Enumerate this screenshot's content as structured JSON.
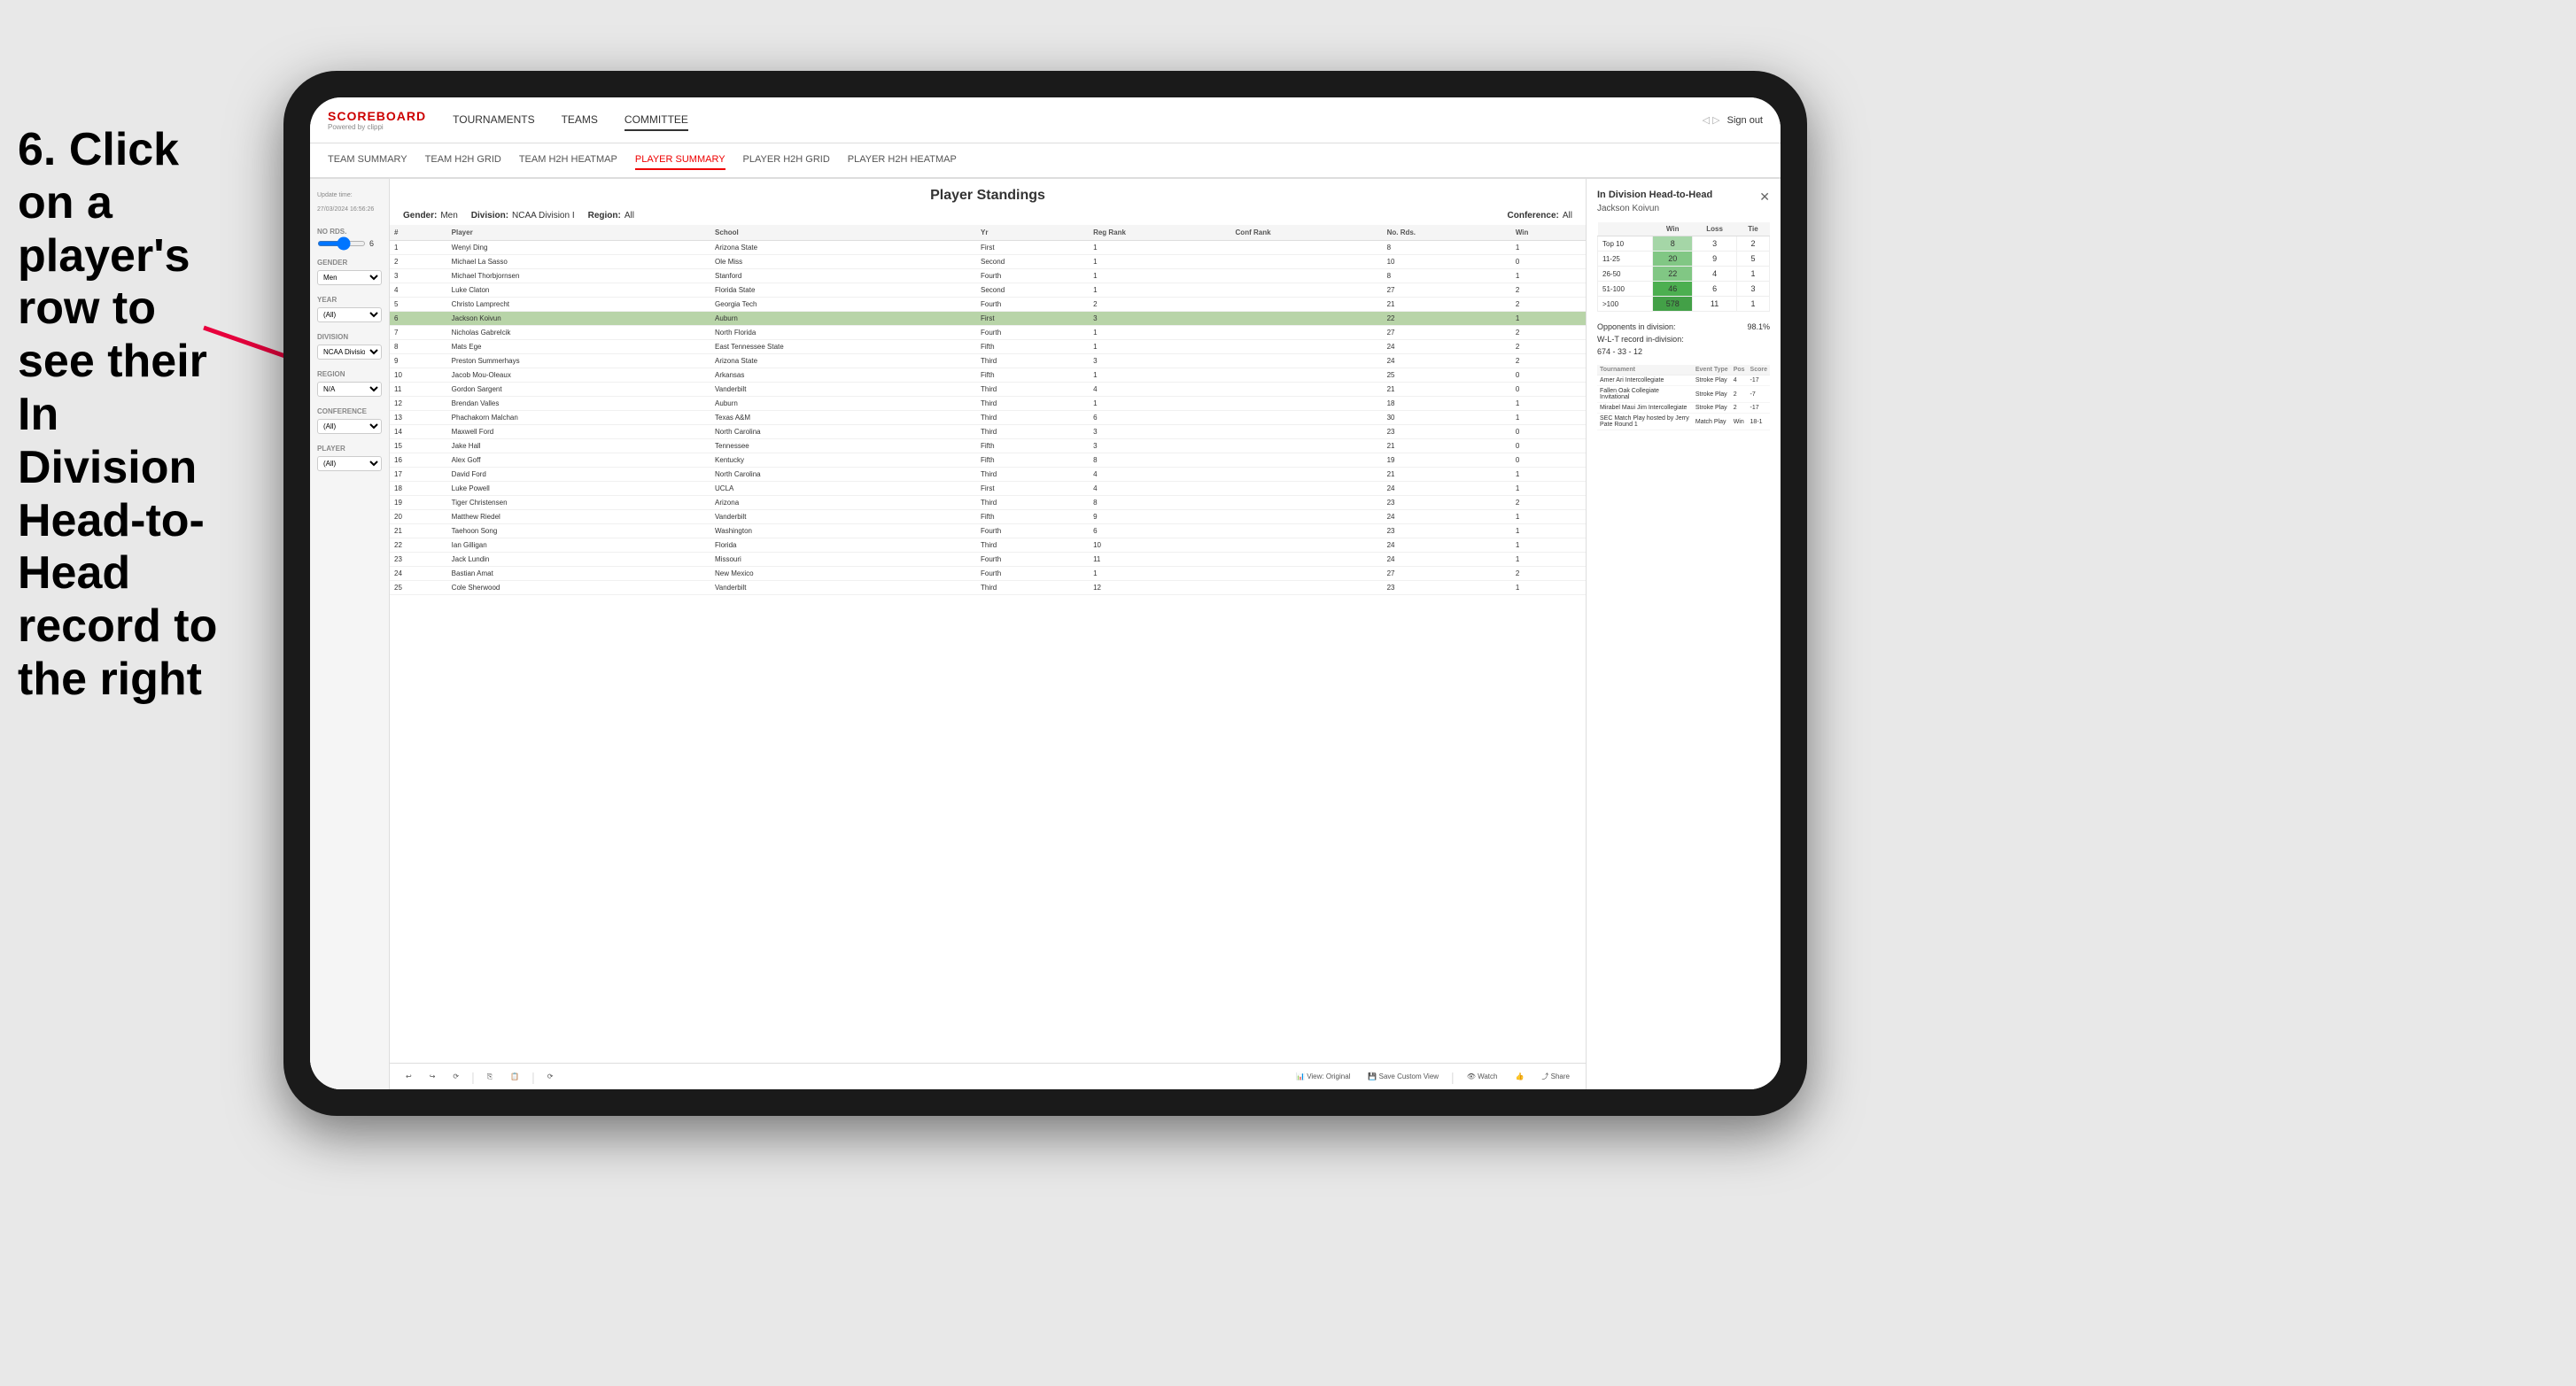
{
  "instruction": {
    "text": "6. Click on a player's row to see their In Division Head-to-Head record to the right"
  },
  "nav": {
    "logo": "SCOREBOARD",
    "logo_sub": "Powered by clippi",
    "items": [
      "TOURNAMENTS",
      "TEAMS",
      "COMMITTEE"
    ],
    "sign_out": "Sign out"
  },
  "sub_nav": {
    "items": [
      "TEAM SUMMARY",
      "TEAM H2H GRID",
      "TEAM H2H HEATMAP",
      "PLAYER SUMMARY",
      "PLAYER H2H GRID",
      "PLAYER H2H HEATMAP"
    ],
    "active": "PLAYER SUMMARY"
  },
  "sidebar": {
    "update_time_label": "Update time:",
    "update_time_value": "27/03/2024 16:56:26",
    "no_rds_label": "No Rds.",
    "no_rds_value": "6",
    "gender_label": "Gender",
    "gender_value": "Men",
    "year_label": "Year",
    "year_value": "(All)",
    "division_label": "Division",
    "division_value": "NCAA Division I",
    "region_label": "Region",
    "region_value": "N/A",
    "conference_label": "Conference",
    "conference_value": "(All)",
    "player_label": "Player",
    "player_value": "(All)"
  },
  "standings": {
    "title": "Player Standings",
    "gender_label": "Gender:",
    "gender_value": "Men",
    "division_label": "Division:",
    "division_value": "NCAA Division I",
    "region_label": "Region:",
    "region_value": "All",
    "conference_label": "Conference:",
    "conference_value": "All",
    "columns": [
      "#",
      "Player",
      "School",
      "Yr",
      "Reg Rank",
      "Conf Rank",
      "No. Rds.",
      "Win"
    ],
    "rows": [
      {
        "rank": 1,
        "player": "Wenyi Ding",
        "school": "Arizona State",
        "yr": "First",
        "reg_rank": 1,
        "conf_rank": "",
        "no_rds": 8,
        "win": 1
      },
      {
        "rank": 2,
        "player": "Michael La Sasso",
        "school": "Ole Miss",
        "yr": "Second",
        "reg_rank": 1,
        "conf_rank": "",
        "no_rds": 10,
        "win": 0
      },
      {
        "rank": 3,
        "player": "Michael Thorbjornsen",
        "school": "Stanford",
        "yr": "Fourth",
        "reg_rank": 1,
        "conf_rank": "",
        "no_rds": 8,
        "win": 1
      },
      {
        "rank": 4,
        "player": "Luke Claton",
        "school": "Florida State",
        "yr": "Second",
        "reg_rank": 1,
        "conf_rank": "",
        "no_rds": 27,
        "win": 2
      },
      {
        "rank": 5,
        "player": "Christo Lamprecht",
        "school": "Georgia Tech",
        "yr": "Fourth",
        "reg_rank": 2,
        "conf_rank": "",
        "no_rds": 21,
        "win": 2
      },
      {
        "rank": 6,
        "player": "Jackson Koivun",
        "school": "Auburn",
        "yr": "First",
        "reg_rank": 3,
        "conf_rank": "",
        "no_rds": 22,
        "win": 1,
        "highlighted": true
      },
      {
        "rank": 7,
        "player": "Nicholas Gabrelcik",
        "school": "North Florida",
        "yr": "Fourth",
        "reg_rank": 1,
        "conf_rank": "",
        "no_rds": 27,
        "win": 2
      },
      {
        "rank": 8,
        "player": "Mats Ege",
        "school": "East Tennessee State",
        "yr": "Fifth",
        "reg_rank": 1,
        "conf_rank": "",
        "no_rds": 24,
        "win": 2
      },
      {
        "rank": 9,
        "player": "Preston Summerhays",
        "school": "Arizona State",
        "yr": "Third",
        "reg_rank": 3,
        "conf_rank": "",
        "no_rds": 24,
        "win": 2
      },
      {
        "rank": 10,
        "player": "Jacob Mou-Oleaux",
        "school": "Arkansas",
        "yr": "Fifth",
        "reg_rank": 1,
        "conf_rank": "",
        "no_rds": 25,
        "win": 0
      },
      {
        "rank": 11,
        "player": "Gordon Sargent",
        "school": "Vanderbilt",
        "yr": "Third",
        "reg_rank": 4,
        "conf_rank": "",
        "no_rds": 21,
        "win": 0
      },
      {
        "rank": 12,
        "player": "Brendan Valles",
        "school": "Auburn",
        "yr": "Third",
        "reg_rank": 1,
        "conf_rank": "",
        "no_rds": 18,
        "win": 1
      },
      {
        "rank": 13,
        "player": "Phachakorn Malchan",
        "school": "Texas A&M",
        "yr": "Third",
        "reg_rank": 6,
        "conf_rank": "",
        "no_rds": 30,
        "win": 1
      },
      {
        "rank": 14,
        "player": "Maxwell Ford",
        "school": "North Carolina",
        "yr": "Third",
        "reg_rank": 3,
        "conf_rank": "",
        "no_rds": 23,
        "win": 0
      },
      {
        "rank": 15,
        "player": "Jake Hall",
        "school": "Tennessee",
        "yr": "Fifth",
        "reg_rank": 3,
        "conf_rank": "",
        "no_rds": 21,
        "win": 0
      },
      {
        "rank": 16,
        "player": "Alex Goff",
        "school": "Kentucky",
        "yr": "Fifth",
        "reg_rank": 8,
        "conf_rank": "",
        "no_rds": 19,
        "win": 0
      },
      {
        "rank": 17,
        "player": "David Ford",
        "school": "North Carolina",
        "yr": "Third",
        "reg_rank": 4,
        "conf_rank": "",
        "no_rds": 21,
        "win": 1
      },
      {
        "rank": 18,
        "player": "Luke Powell",
        "school": "UCLA",
        "yr": "First",
        "reg_rank": 4,
        "conf_rank": "",
        "no_rds": 24,
        "win": 1
      },
      {
        "rank": 19,
        "player": "Tiger Christensen",
        "school": "Arizona",
        "yr": "Third",
        "reg_rank": 8,
        "conf_rank": "",
        "no_rds": 23,
        "win": 2
      },
      {
        "rank": 20,
        "player": "Matthew Riedel",
        "school": "Vanderbilt",
        "yr": "Fifth",
        "reg_rank": 9,
        "conf_rank": "",
        "no_rds": 24,
        "win": 1
      },
      {
        "rank": 21,
        "player": "Taehoon Song",
        "school": "Washington",
        "yr": "Fourth",
        "reg_rank": 6,
        "conf_rank": "",
        "no_rds": 23,
        "win": 1
      },
      {
        "rank": 22,
        "player": "Ian Gilligan",
        "school": "Florida",
        "yr": "Third",
        "reg_rank": 10,
        "conf_rank": "",
        "no_rds": 24,
        "win": 1
      },
      {
        "rank": 23,
        "player": "Jack Lundin",
        "school": "Missouri",
        "yr": "Fourth",
        "reg_rank": 11,
        "conf_rank": "",
        "no_rds": 24,
        "win": 1
      },
      {
        "rank": 24,
        "player": "Bastian Amat",
        "school": "New Mexico",
        "yr": "Fourth",
        "reg_rank": 1,
        "conf_rank": "",
        "no_rds": 27,
        "win": 2
      },
      {
        "rank": 25,
        "player": "Cole Sherwood",
        "school": "Vanderbilt",
        "yr": "Third",
        "reg_rank": 12,
        "conf_rank": "",
        "no_rds": 23,
        "win": 1
      }
    ]
  },
  "h2h_panel": {
    "title": "In Division Head-to-Head",
    "player": "Jackson Koivun",
    "table": {
      "headers": [
        "",
        "Win",
        "Loss",
        "Tie"
      ],
      "rows": [
        {
          "label": "Top 10",
          "win": 8,
          "loss": 3,
          "tie": 2,
          "win_color": "#a5d6a7"
        },
        {
          "label": "11-25",
          "win": 20,
          "loss": 9,
          "tie": 5,
          "win_color": "#81c784"
        },
        {
          "label": "26-50",
          "win": 22,
          "loss": 4,
          "tie": 1,
          "win_color": "#81c784"
        },
        {
          "label": "51-100",
          "win": 46,
          "loss": 6,
          "tie": 3,
          "win_color": "#4caf50"
        },
        {
          "label": ">100",
          "win": 578,
          "loss": 11,
          "tie": 1,
          "win_color": "#43a047"
        }
      ]
    },
    "opponents_label": "Opponents in division:",
    "opponents_pct": "98.1%",
    "wlt_label": "W-L-T record in-division:",
    "wlt_value": "674 - 33 - 12",
    "tournament_headers": [
      "Tournament",
      "Event Type",
      "Pos",
      "Score"
    ],
    "tournaments": [
      {
        "name": "Amer Ari Intercollegiate",
        "type": "Stroke Play",
        "pos": 4,
        "score": "-17"
      },
      {
        "name": "Fallen Oak Collegiate Invitational",
        "type": "Stroke Play",
        "pos": 2,
        "score": "-7"
      },
      {
        "name": "Mirabel Maui Jim Intercollegiate",
        "type": "Stroke Play",
        "pos": 2,
        "score": "-17"
      },
      {
        "name": "SEC Match Play hosted by Jerry Pate Round 1",
        "type": "Match Play",
        "pos": "Win",
        "score": "18-1"
      }
    ]
  },
  "toolbar": {
    "view_original": "View: Original",
    "save_custom": "Save Custom View",
    "watch": "Watch",
    "share": "Share"
  },
  "colors": {
    "accent_red": "#cc0000",
    "nav_active_red": "#e00000",
    "highlighted_row": "#b8d4a8"
  }
}
